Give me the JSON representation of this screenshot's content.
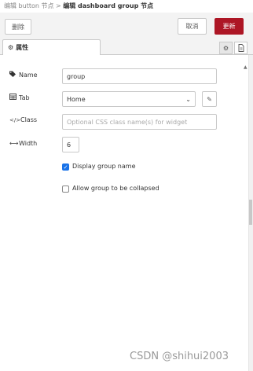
{
  "breadcrumb": {
    "prefix": "编辑 button 节点 > ",
    "current": "编辑 dashboard group 节点"
  },
  "actions": {
    "delete_label": "删除",
    "cancel_label": "取消",
    "update_label": "更新"
  },
  "tabs": {
    "properties_label": "属性",
    "properties_icon": "gear-icon"
  },
  "form": {
    "name": {
      "label": "Name",
      "value": "group",
      "icon": "tag-icon"
    },
    "tab": {
      "label": "Tab",
      "value": "Home",
      "icon": "table-icon"
    },
    "class": {
      "label": "Class",
      "placeholder": "Optional CSS class name(s) for widget",
      "icon": "code-icon"
    },
    "width": {
      "label": "Width",
      "value": "6",
      "icon": "arrows-h-icon"
    },
    "display_group_name": {
      "label": "Display group name",
      "checked": true
    },
    "collapsible": {
      "label": "Allow group to be collapsed",
      "checked": false
    }
  },
  "watermark": "CSDN @shihui2003",
  "colors": {
    "accent": "#ad1625",
    "checkbox": "#1a73e8"
  }
}
